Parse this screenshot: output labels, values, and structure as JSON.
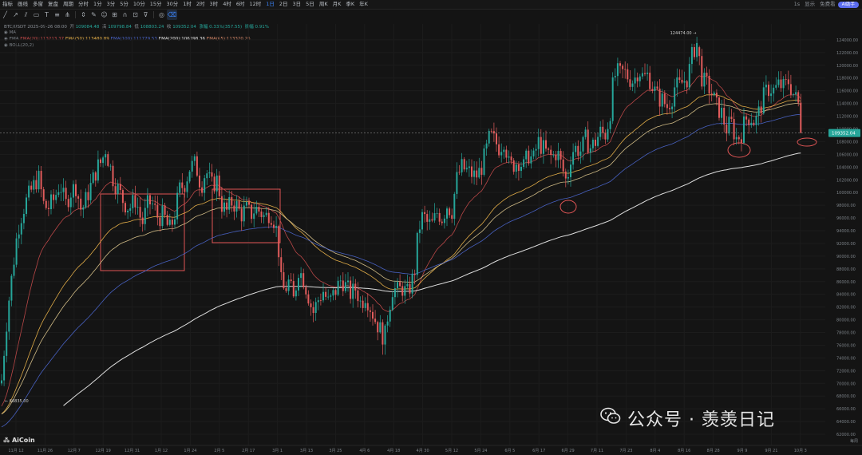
{
  "topbar": {
    "items": [
      "指标",
      "画线",
      "多窗",
      "复盘",
      "周期",
      "分时",
      "1分",
      "3分",
      "5分",
      "10分",
      "15分",
      "30分",
      "1时",
      "2时",
      "3时",
      "4时",
      "6时",
      "12时",
      "1日",
      "2日",
      "3日",
      "5日",
      "周K",
      "月K",
      "季K",
      "年K"
    ],
    "active": "1日",
    "right": [
      "1s",
      "显示",
      "免费看"
    ],
    "badge": "AI助手"
  },
  "toolbar": {
    "icons": [
      "line-tool-icon",
      "arrow-tool-icon",
      "parallel-tool-icon",
      "rect-tool-icon",
      "text-tool-icon",
      "fib-tool-icon",
      "pitchfork-tool-icon",
      "measure-tool-icon",
      "brush-tool-icon",
      "emoji-tool-icon",
      "ruler-tool-icon",
      "magnet-tool-icon",
      "lock-tool-icon",
      "filter-tool-icon",
      "eye-tool-icon",
      "trash-tool-icon"
    ]
  },
  "legend": {
    "symbol_line": "BTC/USDT  2025-09-26 08:00",
    "o": "109084.48",
    "h": "109798.84",
    "l": "108803.24",
    "c": "109352.04",
    "change": "涨幅 0.33%(357.55)",
    "amp": "振幅 0.91%",
    "ma_label": "MA",
    "ema_line_label": "EMA",
    "ema20": "EMA(20):113213.37",
    "ema50": "EMA(50):113480.89",
    "ema100": "EMA(100):111779.53",
    "ema200": "EMA(200):106098.36",
    "ema65": "EMA(65):113320.26",
    "boll": "BOLL(20,2)"
  },
  "chart_data": {
    "type": "candlestick",
    "symbol": "BTC/USDT",
    "interval": "1日",
    "y_ticks": [
      124000,
      122000,
      120000,
      118000,
      116000,
      114000,
      112000,
      110000,
      108000,
      106000,
      104000,
      102000,
      100000,
      98000,
      96000,
      94000,
      92000,
      90000,
      88000,
      86000,
      84000,
      82000,
      80000,
      78000,
      76000,
      74000,
      72000,
      70000,
      68000,
      66000,
      64000,
      62000
    ],
    "ylim": [
      61000,
      126500
    ],
    "x_ticks": [
      "11月 12",
      "11月 26",
      "12月 7",
      "12月 19",
      "12月 31",
      "1月 12",
      "1月 24",
      "2月 5",
      "2月 17",
      "3月 1",
      "3月 13",
      "3月 25",
      "4月 6",
      "4月 18",
      "4月 30",
      "5月 12",
      "5月 24",
      "6月 5",
      "6月 17",
      "6月 29",
      "7月 11",
      "7月 23",
      "8月 4",
      "8月 16",
      "8月 28",
      "9月 9",
      "9月 21",
      "10月 3"
    ],
    "corner_label": "每周",
    "last_price": "109352.04",
    "high_label": "124474.00",
    "low_label": "66835.00",
    "price_path": [
      [
        0,
        67500
      ],
      [
        5,
        75000
      ],
      [
        10,
        82000
      ],
      [
        16,
        88000
      ],
      [
        22,
        94000
      ],
      [
        28,
        97000
      ],
      [
        34,
        99000
      ],
      [
        40,
        100500
      ],
      [
        48,
        102500
      ],
      [
        55,
        98000
      ],
      [
        60,
        97500
      ],
      [
        68,
        99000
      ],
      [
        75,
        101500
      ],
      [
        82,
        98000
      ],
      [
        88,
        100000
      ],
      [
        95,
        101000
      ],
      [
        102,
        97000
      ],
      [
        108,
        99000
      ],
      [
        115,
        101500
      ],
      [
        122,
        104000
      ],
      [
        128,
        105000
      ],
      [
        132,
        107000
      ],
      [
        136,
        105000
      ],
      [
        142,
        102000
      ],
      [
        148,
        100500
      ],
      [
        155,
        98500
      ],
      [
        162,
        97500
      ],
      [
        170,
        99000
      ],
      [
        178,
        95000
      ],
      [
        186,
        98500
      ],
      [
        192,
        98000
      ],
      [
        198,
        96000
      ],
      [
        205,
        96500
      ],
      [
        212,
        94000
      ],
      [
        218,
        96000
      ],
      [
        225,
        100500
      ],
      [
        232,
        101500
      ],
      [
        238,
        104000
      ],
      [
        245,
        104500
      ],
      [
        252,
        101000
      ],
      [
        258,
        103500
      ],
      [
        265,
        101000
      ],
      [
        272,
        102000
      ],
      [
        278,
        98000
      ],
      [
        284,
        97000
      ],
      [
        290,
        98500
      ],
      [
        296,
        98000
      ],
      [
        302,
        96500
      ],
      [
        308,
        97500
      ],
      [
        314,
        96500
      ],
      [
        320,
        97500
      ],
      [
        326,
        97000
      ],
      [
        332,
        96000
      ],
      [
        338,
        97000
      ],
      [
        344,
        95500
      ],
      [
        348,
        93000
      ],
      [
        352,
        86000
      ],
      [
        356,
        84500
      ],
      [
        362,
        86000
      ],
      [
        368,
        83000
      ],
      [
        374,
        88000
      ],
      [
        380,
        86500
      ],
      [
        386,
        84000
      ],
      [
        392,
        81000
      ],
      [
        398,
        83000
      ],
      [
        405,
        84500
      ],
      [
        412,
        82500
      ],
      [
        420,
        84500
      ],
      [
        428,
        86500
      ],
      [
        434,
        85000
      ],
      [
        440,
        84000
      ],
      [
        446,
        85000
      ],
      [
        452,
        82500
      ],
      [
        458,
        84000
      ],
      [
        464,
        82000
      ],
      [
        470,
        80000
      ],
      [
        476,
        78500
      ],
      [
        482,
        77000
      ],
      [
        486,
        81000
      ],
      [
        492,
        85000
      ],
      [
        498,
        84500
      ],
      [
        504,
        85000
      ],
      [
        510,
        84000
      ],
      [
        516,
        86000
      ],
      [
        520,
        88000
      ],
      [
        524,
        94000
      ],
      [
        530,
        96500
      ],
      [
        536,
        95000
      ],
      [
        542,
        95000
      ],
      [
        548,
        97000
      ],
      [
        554,
        96000
      ],
      [
        560,
        98000
      ],
      [
        566,
        97000
      ],
      [
        572,
        102000
      ],
      [
        578,
        104000
      ],
      [
        584,
        103500
      ],
      [
        590,
        103000
      ],
      [
        596,
        102500
      ],
      [
        602,
        103500
      ],
      [
        608,
        106000
      ],
      [
        614,
        109000
      ],
      [
        620,
        108000
      ],
      [
        626,
        107000
      ],
      [
        632,
        108500
      ],
      [
        638,
        104000
      ],
      [
        644,
        104500
      ],
      [
        650,
        105000
      ],
      [
        656,
        104000
      ],
      [
        662,
        106000
      ],
      [
        668,
        105000
      ],
      [
        674,
        108000
      ],
      [
        680,
        107000
      ],
      [
        686,
        106000
      ],
      [
        692,
        105500
      ],
      [
        698,
        106500
      ],
      [
        704,
        104000
      ],
      [
        710,
        101500
      ],
      [
        716,
        106500
      ],
      [
        722,
        107000
      ],
      [
        728,
        106500
      ],
      [
        734,
        108500
      ],
      [
        740,
        107000
      ],
      [
        746,
        108000
      ],
      [
        752,
        109500
      ],
      [
        758,
        109000
      ],
      [
        764,
        112000
      ],
      [
        768,
        117000
      ],
      [
        772,
        119000
      ],
      [
        776,
        118500
      ],
      [
        782,
        119000
      ],
      [
        788,
        118000
      ],
      [
        794,
        117500
      ],
      [
        800,
        119500
      ],
      [
        806,
        118000
      ],
      [
        812,
        118500
      ],
      [
        818,
        116500
      ],
      [
        824,
        115000
      ],
      [
        830,
        114500
      ],
      [
        836,
        113500
      ],
      [
        842,
        115000
      ],
      [
        846,
        117000
      ],
      [
        850,
        116500
      ],
      [
        856,
        117500
      ],
      [
        862,
        118000
      ],
      [
        866,
        121000
      ],
      [
        872,
        123500
      ],
      [
        876,
        121000
      ],
      [
        880,
        117500
      ],
      [
        886,
        117000
      ],
      [
        892,
        115500
      ],
      [
        898,
        113500
      ],
      [
        904,
        112500
      ],
      [
        910,
        110000
      ],
      [
        916,
        111000
      ],
      [
        922,
        108500
      ],
      [
        928,
        109000
      ],
      [
        934,
        111500
      ],
      [
        940,
        112000
      ],
      [
        946,
        111000
      ],
      [
        952,
        113000
      ],
      [
        958,
        115500
      ],
      [
        964,
        116500
      ],
      [
        970,
        116000
      ],
      [
        976,
        117000
      ],
      [
        982,
        116500
      ],
      [
        988,
        117500
      ],
      [
        994,
        115500
      ],
      [
        1000,
        114000
      ],
      [
        1006,
        109352
      ]
    ],
    "series": [
      {
        "name": "EMA(20)",
        "color": "#c24a4a"
      },
      {
        "name": "EMA(50)",
        "color": "#e9b24a"
      },
      {
        "name": "EMA(100)",
        "color": "#4a64c8"
      },
      {
        "name": "EMA(200)",
        "color": "#e8e8e8"
      },
      {
        "name": "EMA(65)",
        "color": "#d8c28a"
      }
    ]
  }
}
